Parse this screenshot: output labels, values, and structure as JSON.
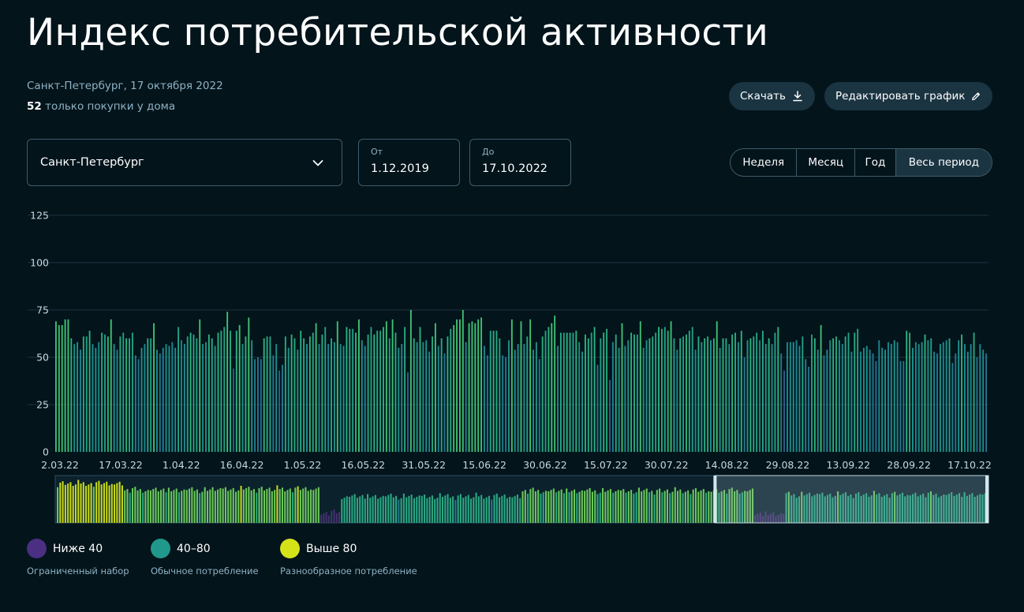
{
  "header": {
    "title": "Индекс потребительской активности",
    "subtitle": "Санкт-Петербург, 17 октября 2022",
    "count_value": "52",
    "count_text": " только покупки у дома"
  },
  "toolbar": {
    "download_label": "Скачать",
    "edit_label": "Редактировать график"
  },
  "filters": {
    "city": "Санкт-Петербург",
    "from_label": "От",
    "from_value": "1.12.2019",
    "to_label": "До",
    "to_value": "17.10.2022"
  },
  "period_tabs": [
    {
      "label": "Неделя",
      "active": false
    },
    {
      "label": "Месяц",
      "active": false
    },
    {
      "label": "Год",
      "active": false
    },
    {
      "label": "Весь период",
      "active": true
    }
  ],
  "colors": {
    "low": "#4b2f83",
    "mid": "#21988c",
    "high": "#d4e21a"
  },
  "legend": [
    {
      "label": "Ниже 40",
      "desc": "Ограниченный набор",
      "color": "#4b2f83"
    },
    {
      "label": "40–80",
      "desc": "Обычное потребление",
      "color": "#21988c"
    },
    {
      "label": "Выше 80",
      "desc": "Разнообразное потребление",
      "color": "#d4e21a"
    }
  ],
  "chart_data": {
    "type": "bar",
    "title": "",
    "xlabel": "",
    "ylabel": "",
    "ylim": [
      0,
      125
    ],
    "yticks": [
      0,
      25,
      50,
      75,
      100,
      125
    ],
    "grid": true,
    "x_tick_labels": [
      "2.03.22",
      "17.03.22",
      "1.04.22",
      "16.04.22",
      "1.05.22",
      "16.05.22",
      "31.05.22",
      "15.06.22",
      "30.06.22",
      "15.07.22",
      "30.07.22",
      "14.08.22",
      "29.08.22",
      "13.09.22",
      "28.09.22",
      "17.10.22"
    ],
    "x_start": "2022-03-02",
    "x_end": "2022-10-17",
    "values": [
      69,
      67,
      67,
      70,
      70,
      60,
      57,
      58,
      54,
      61,
      61,
      64,
      57,
      55,
      58,
      63,
      62,
      61,
      70,
      57,
      54,
      61,
      63,
      60,
      60,
      63,
      51,
      49,
      55,
      57,
      60,
      60,
      68,
      54,
      52,
      55,
      57,
      56,
      58,
      55,
      66,
      59,
      57,
      61,
      63,
      62,
      60,
      70,
      57,
      58,
      62,
      60,
      56,
      63,
      64,
      66,
      74,
      64,
      44,
      64,
      67,
      57,
      61,
      71,
      59,
      49,
      50,
      49,
      60,
      61,
      61,
      51,
      57,
      43,
      46,
      61,
      55,
      62,
      60,
      54,
      64,
      60,
      57,
      61,
      63,
      68,
      57,
      62,
      66,
      57,
      60,
      58,
      69,
      57,
      56,
      66,
      65,
      65,
      63,
      70,
      59,
      56,
      62,
      66,
      62,
      64,
      64,
      66,
      69,
      60,
      70,
      63,
      55,
      57,
      66,
      42,
      75,
      60,
      58,
      66,
      58,
      59,
      53,
      61,
      68,
      56,
      60,
      52,
      61,
      65,
      67,
      70,
      70,
      75,
      58,
      68,
      69,
      68,
      70,
      71,
      56,
      51,
      64,
      64,
      64,
      60,
      51,
      50,
      59,
      70,
      54,
      57,
      69,
      57,
      61,
      70,
      54,
      58,
      49,
      61,
      64,
      66,
      68,
      72,
      56,
      63,
      63,
      63,
      63,
      63,
      64,
      58,
      53,
      62,
      60,
      63,
      66,
      46,
      60,
      63,
      65,
      38,
      58,
      62,
      55,
      68,
      56,
      59,
      63,
      62,
      62,
      69,
      55,
      59,
      60,
      61,
      63,
      66,
      65,
      66,
      64,
      69,
      60,
      54,
      60,
      61,
      62,
      64,
      66,
      54,
      61,
      58,
      60,
      61,
      59,
      60,
      69,
      55,
      60,
      60,
      57,
      62,
      63,
      58,
      64,
      50,
      59,
      60,
      61,
      63,
      59,
      64,
      57,
      60,
      57,
      63,
      66,
      52,
      43,
      58,
      58,
      58,
      59,
      56,
      61,
      49,
      45,
      62,
      60,
      54,
      67,
      51,
      54,
      59,
      60,
      61,
      59,
      57,
      61,
      63,
      53,
      63,
      65,
      53,
      55,
      56,
      54,
      52,
      48,
      59,
      55,
      54,
      58,
      57,
      59,
      58,
      48,
      48,
      64,
      63,
      55,
      58,
      57,
      58,
      62,
      59,
      60,
      53,
      52,
      57,
      58,
      59,
      60,
      47,
      52,
      59,
      62,
      57,
      53,
      57,
      63,
      50,
      57,
      54,
      52
    ],
    "overview": {
      "type": "bar",
      "ylim": [
        0,
        100
      ],
      "selection_start_fraction": 0.707,
      "selection_end_fraction": 1.0
    }
  }
}
